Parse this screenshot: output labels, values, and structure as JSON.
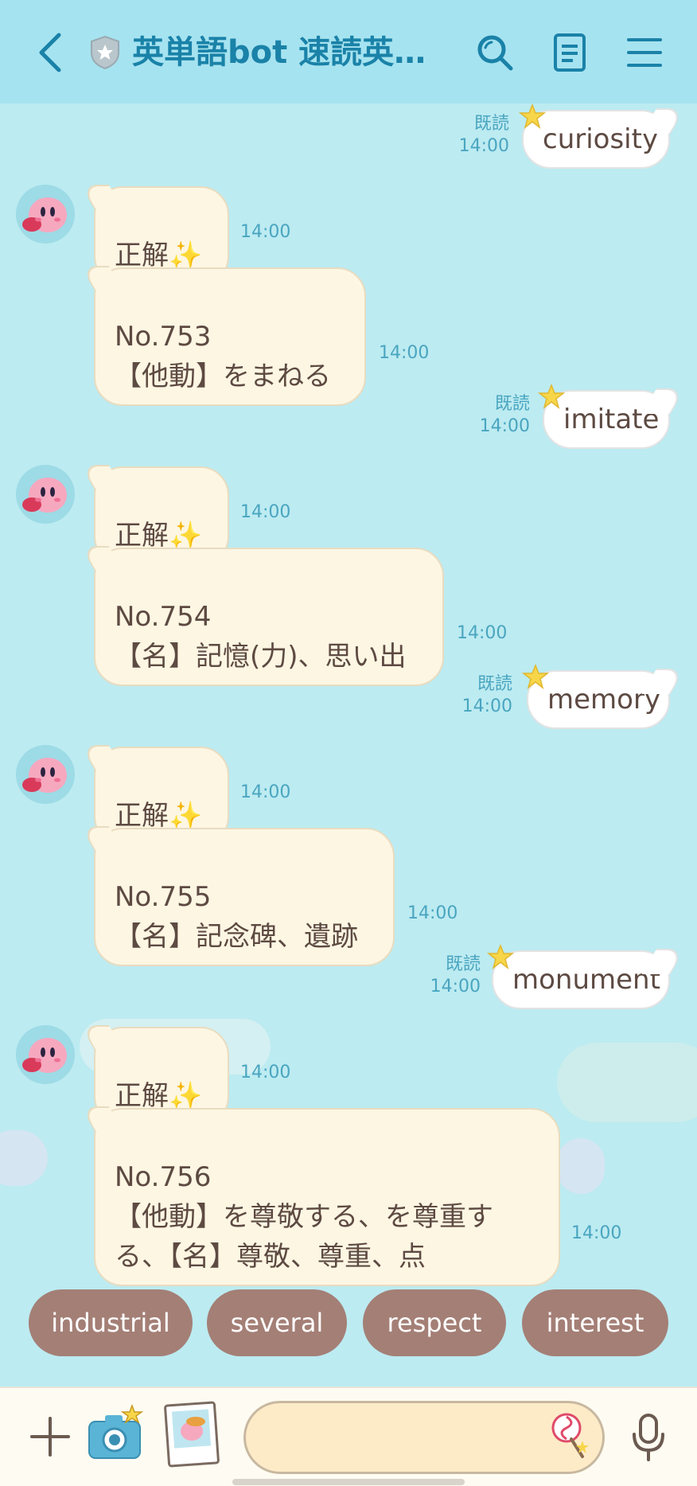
{
  "header": {
    "title": "英単語bot 速読英単…",
    "icons": [
      "back-arrow-icon",
      "shield-star-icon",
      "search-icon",
      "note-icon",
      "menu-icon"
    ]
  },
  "messages": [
    {
      "type": "out",
      "text": "curiosity",
      "read": "既読",
      "time": "14:00"
    },
    {
      "type": "in",
      "text": "正解✨",
      "time": "14:00"
    },
    {
      "type": "in",
      "text": "No.753\n【他動】をまねる",
      "time": "14:00"
    },
    {
      "type": "out",
      "text": "imitate",
      "read": "既読",
      "time": "14:00"
    },
    {
      "type": "in",
      "text": "正解✨",
      "time": "14:00"
    },
    {
      "type": "in",
      "text": "No.754\n【名】記憶(力)、思い出",
      "time": "14:00"
    },
    {
      "type": "out",
      "text": "memory",
      "read": "既読",
      "time": "14:00"
    },
    {
      "type": "in",
      "text": "正解✨",
      "time": "14:00"
    },
    {
      "type": "in",
      "text": "No.755\n【名】記念碑、遺跡",
      "time": "14:00"
    },
    {
      "type": "out",
      "text": "monument",
      "read": "既読",
      "time": "14:00"
    },
    {
      "type": "in",
      "text": "正解✨",
      "time": "14:00"
    },
    {
      "type": "in",
      "text": "No.756\n【他動】を尊敬する、を尊重す\nる、【名】尊敬、尊重、点",
      "time": "14:00"
    }
  ],
  "quick_replies": [
    "industrial",
    "several",
    "respect",
    "interest"
  ],
  "footer": {
    "input_placeholder": "",
    "icons": [
      "plus-icon",
      "camera-icon",
      "sticker-icon",
      "candy-icon",
      "microphone-icon"
    ]
  },
  "colors": {
    "header_bg": "#a6e3f0",
    "title": "#1a82a8",
    "chat_bg": "#bcebf1",
    "incoming_bubble": "#fdf6e3",
    "outgoing_bubble": "#ffffff",
    "time_text": "#4aa5c0",
    "quick_reply_bg": "#a47f76",
    "input_bg": "#fdebc8"
  }
}
